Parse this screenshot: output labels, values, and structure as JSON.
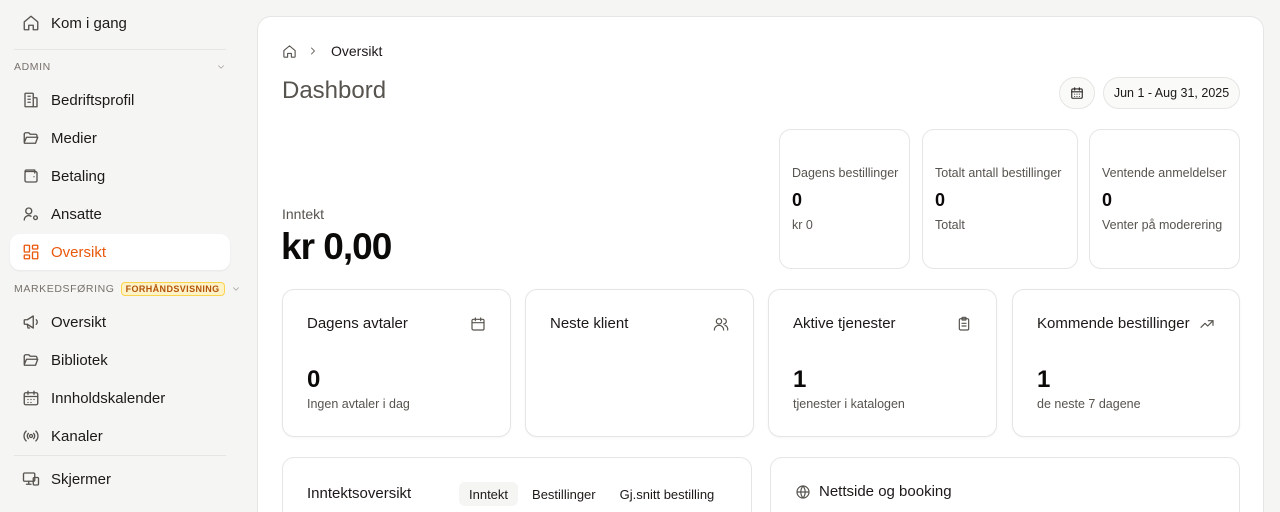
{
  "sidebar": {
    "top_item": {
      "label": "Kom i gang",
      "icon": "home-icon"
    },
    "admin_section": {
      "title": "ADMIN"
    },
    "admin_items": [
      {
        "label": "Bedriftsprofil",
        "icon": "building-icon"
      },
      {
        "label": "Medier",
        "icon": "folder-open-icon"
      },
      {
        "label": "Betaling",
        "icon": "wallet-icon"
      },
      {
        "label": "Ansatte",
        "icon": "user-cog-icon"
      },
      {
        "label": "Oversikt",
        "icon": "dashboard-icon",
        "active": true
      }
    ],
    "marketing_section": {
      "title": "MARKEDSFØRING",
      "badge": "FORHÅNDSVISNING"
    },
    "marketing_items": [
      {
        "label": "Oversikt",
        "icon": "megaphone-icon"
      },
      {
        "label": "Bibliotek",
        "icon": "folder-icon"
      },
      {
        "label": "Innholdskalender",
        "icon": "calendar-icon"
      },
      {
        "label": "Kanaler",
        "icon": "radio-icon"
      }
    ],
    "bottom_item": {
      "label": "Skjermer",
      "icon": "screens-icon"
    }
  },
  "header": {
    "breadcrumb": {
      "current": "Oversikt"
    },
    "title": "Dashbord",
    "date_range": "Jun 1 - Aug 31, 2025"
  },
  "revenue": {
    "label": "Inntekt",
    "value": "kr 0,00"
  },
  "kpis": [
    {
      "title": "Dagens bestillinger",
      "value": "0",
      "sub": "kr 0"
    },
    {
      "title": "Totalt antall bestillinger",
      "value": "0",
      "sub": "Totalt"
    },
    {
      "title": "Ventende anmeldelser",
      "value": "0",
      "sub": "Venter på moderering"
    }
  ],
  "cards": [
    {
      "title": "Dagens avtaler",
      "icon": "calendar-icon",
      "value": "0",
      "sub": "Ingen avtaler i dag"
    },
    {
      "title": "Neste klient",
      "icon": "users-icon",
      "value": "",
      "sub": ""
    },
    {
      "title": "Aktive tjenester",
      "icon": "clipboard-icon",
      "value": "1",
      "sub": "tjenester i katalogen"
    },
    {
      "title": "Kommende bestillinger",
      "icon": "trending-up-icon",
      "value": "1",
      "sub": "de neste 7 dagene"
    }
  ],
  "revenue_overview": {
    "title": "Inntektsoversikt",
    "tabs": [
      {
        "label": "Inntekt",
        "active": true
      },
      {
        "label": "Bestillinger",
        "active": false
      },
      {
        "label": "Gj.snitt bestilling",
        "active": false
      }
    ]
  },
  "website_panel": {
    "title": "Nettside og booking",
    "icon": "globe-icon"
  },
  "colors": {
    "accent": "#ea580c",
    "badge_bg": "#fef3c7",
    "badge_text": "#b45309"
  }
}
